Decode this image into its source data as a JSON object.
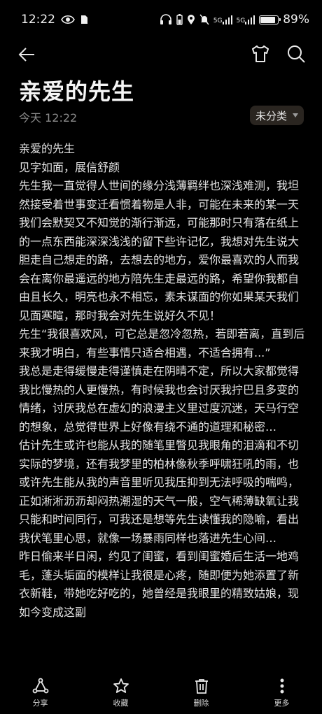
{
  "status_bar": {
    "time": "12:22",
    "signal_label": "5G",
    "battery_level": 0.89,
    "battery_text": "89%"
  },
  "toolbar": {
    "back_icon": "back-arrow-icon",
    "shirt_icon": "shirt-icon",
    "search_icon": "search-icon"
  },
  "note": {
    "title": "亲爱的先生",
    "timestamp": "今天 12:22",
    "category": "未分类",
    "paragraphs": [
      "亲爱的先生",
      "见字如面，展信舒颜",
      "先生我一直觉得人世间的缘分浅薄羁绊也深浅难测，我坦然接受着世事变迁看惯着物是人非，可能在未来的某一天我们会默契又不知觉的渐行渐远，可能那时只有落在纸上的一点东西能深深浅浅的留下些许记忆，我想对先生说大胆走自己想走的路，去想去的地方，爱你最喜欢的人而我会在离你最遥远的地方陪先生走最远的路，希望你我都自由且长久，明亮也永不相忘，素未谋面的你如果某天我们见面寒暄，那时我会对先生说好久不见！",
      "先生“我很喜欢风，可它总是忽冷忽热，若即若离，直到后来我才明白，有些事情只适合相遇，不适合拥有...”",
      "我总是走得缓慢走得谨慎走在阴晴不定，所以大家都觉得我比慢热的人更慢热，有时候我也会讨厌我拧巴且多变的情绪，讨厌我总在虚幻的浪漫主义里过度沉迷，天马行空的想象，总觉得世界上好像有绕不通的道理和秘密…",
      "估计先生或许也能从我的随笔里瞥见我眼角的泪滴和不切实际的梦境，还有我梦里的柏林像秋季呼啸狂吼的雨，也或许先生能从我的声音里听见我压抑到无法呼吸的喘鸣，正如淅淅沥沥却闷热潮湿的天气一般，空气稀薄缺氧让我只能和时间同行，可我还是想等先生读懂我的隐喻，看出我伏笔里心思，就像一场暴雨同样也落进先生心间…",
      "昨日偷来半日闲，约见了闺蜜，看到闺蜜婚后生活一地鸡毛，蓬头垢面的模样让我很是心疼，随即便为她添置了新衣新鞋，带她吃好吃的，她曾经是我眼里的精致姑娘，现如今变成这副"
    ]
  },
  "bottom_bar": {
    "share_label": "分享",
    "favorite_label": "收藏",
    "delete_label": "删除",
    "more_label": "更多"
  }
}
